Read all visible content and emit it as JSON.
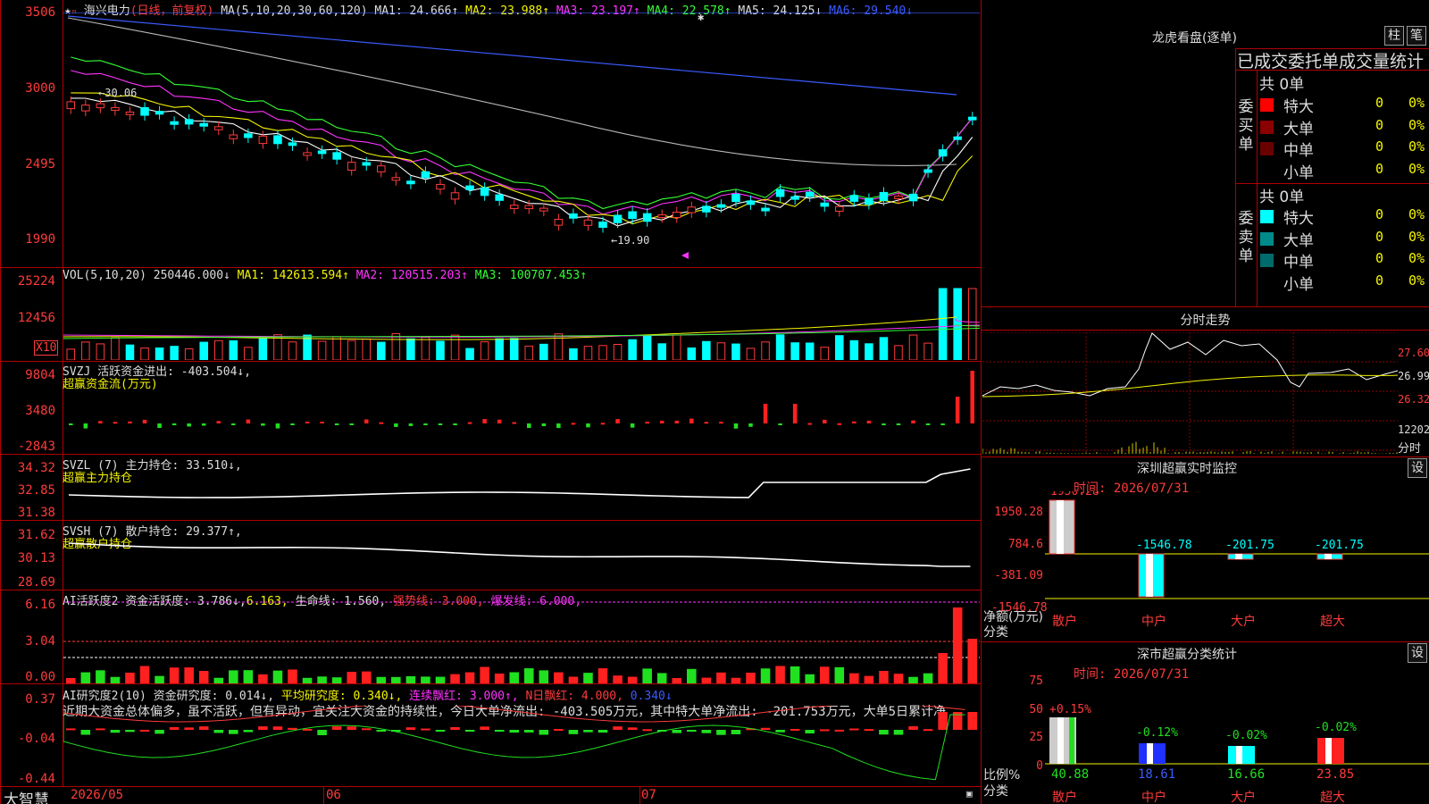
{
  "app": {
    "brand": "大智慧"
  },
  "kline": {
    "title": "海兴电力",
    "period": "(日线，前复权)",
    "ma_label": "MA(5,10,20,30,60,120)",
    "ma": [
      {
        "name": "MA1:",
        "value": "24.666↑",
        "color": "#ddd"
      },
      {
        "name": "MA2:",
        "value": "23.988↑",
        "color": "#f5f500"
      },
      {
        "name": "MA3:",
        "value": "23.197↑",
        "color": "#ff33ff"
      },
      {
        "name": "MA4:",
        "value": "22.578↑",
        "color": "#33ff33"
      },
      {
        "name": "MA5:",
        "value": "24.125↓",
        "color": "#ddd"
      },
      {
        "name": "MA6:",
        "value": "29.540↓",
        "color": "#3b5bff"
      }
    ],
    "y_ticks": [
      "3506",
      "3000",
      "2495",
      "1990"
    ],
    "high_mark": "←30.06",
    "low_mark": "←19.90"
  },
  "vol": {
    "label": "VOL(5,10,20)",
    "value": "250446.000↓",
    "ma1": "MA1: 142613.594↑",
    "ma2": "MA2: 120515.203↑",
    "ma3": "MA3: 100707.453↑",
    "y_ticks": [
      "25224",
      "12456"
    ],
    "unit": "X10"
  },
  "svzj": {
    "label": "SVZJ",
    "line1": "活跃资金进出: -403.504↓,",
    "line2": "超赢资金流(万元)",
    "y_ticks": [
      "9804",
      "3480",
      "-2843"
    ]
  },
  "svzl": {
    "label": "SVZL (7)",
    "line1": "主力持仓: 33.510↓,",
    "line2": "超赢主力持仓",
    "y_ticks": [
      "34.32",
      "32.85",
      "31.38"
    ]
  },
  "svsh": {
    "label": "SVSH (7)",
    "line1": "散户持仓: 29.377↑,",
    "line2": "超赢散户持仓",
    "y_ticks": [
      "31.62",
      "30.13",
      "28.69"
    ]
  },
  "ai_active": {
    "label": "AI活跃度2 资金活跃度:",
    "v1": "3.786↓,",
    "v2": "6.163,",
    "v3": "生命线: 1.560,",
    "v4": "强势线: 3.000,",
    "v5": "爆发线: 6.000,",
    "y_ticks": [
      "6.16",
      "3.04",
      "0.00"
    ]
  },
  "ai_research": {
    "label": "AI研究度2(10) 资金研究度: 0.014↓,",
    "v1": "平均研究度: 0.340↓,",
    "v2": "连续飘红: 3.000↑,",
    "v3": "N日飘红: 4.000,",
    "v4": "0.340↓",
    "commentary": "近期大资金总体偏多，虽不活跃，但有异动，宜关注大资金的持续性，今日大单净流出: -403.505万元，其中特大单净流出: -201.753万元，大单5日累计净",
    "y_ticks": [
      "0.37",
      "-0.04",
      "-0.44"
    ]
  },
  "x_axis": {
    "labels": [
      "2026/05",
      "06",
      "07"
    ]
  },
  "longhu": {
    "title": "龙虎看盘(逐单)",
    "tabs": [
      "柱",
      "笔"
    ],
    "stat_title": "已成交委托单成交量统计",
    "buy_side": {
      "label": "委买单",
      "total": "共 0单",
      "rows": [
        {
          "name": "特大",
          "count": "0",
          "pct": "0%",
          "color": "#ff0000"
        },
        {
          "name": "大单",
          "count": "0",
          "pct": "0%",
          "color": "#8b0000"
        },
        {
          "name": "中单",
          "count": "0",
          "pct": "0%",
          "color": "#6b0000"
        },
        {
          "name": "小单",
          "count": "0",
          "pct": "0%",
          "color": "#000"
        }
      ]
    },
    "sell_side": {
      "label": "委卖单",
      "total": "共 0单",
      "rows": [
        {
          "name": "特大",
          "count": "0",
          "pct": "0%",
          "color": "#00ffff"
        },
        {
          "name": "大单",
          "count": "0",
          "pct": "0%",
          "color": "#008b8b"
        },
        {
          "name": "中单",
          "count": "0",
          "pct": "0%",
          "color": "#006b6b"
        },
        {
          "name": "小单",
          "count": "0",
          "pct": "0%",
          "color": "#000"
        }
      ]
    }
  },
  "intraday": {
    "title": "分时走势",
    "y_ticks": [
      "27.60",
      "26.99",
      "26.32"
    ],
    "vol_label": "12202",
    "bottom_label": "分时"
  },
  "sz_monitor": {
    "title": "深圳超赢实时监控",
    "btn": "设",
    "time": "时间: 2026/07/31",
    "y_ticks": [
      "1950.28",
      "784.6",
      "-381.09",
      "-1546.78"
    ],
    "values": [
      "1950.28",
      "-1546.78",
      "-201.75",
      "-201.75"
    ],
    "ylabel": "净额(万元)",
    "xlabel": "分类",
    "categories": [
      "散户",
      "中户",
      "大户",
      "超大"
    ]
  },
  "sz_class": {
    "title": "深市超赢分类统计",
    "btn": "设",
    "time": "时间: 2026/07/31",
    "y_ticks": [
      "75",
      "50",
      "25",
      "0"
    ],
    "pct_labels": [
      "+0.15%",
      "-0.12%",
      "-0.02%",
      "-0.02%"
    ],
    "values": [
      "40.88",
      "18.61",
      "16.66",
      "23.85"
    ],
    "ylabel": "比例%",
    "xlabel": "分类",
    "categories": [
      "散户",
      "中户",
      "大户",
      "超大"
    ]
  },
  "chart_data": [
    {
      "type": "candlestick",
      "title": "海兴电力",
      "ylabel": "",
      "ylim": [
        17.5,
        35.5
      ]
    },
    {
      "type": "bar",
      "title": "VOL(5,10,20)",
      "ylim": [
        0,
        25224
      ]
    },
    {
      "type": "bar",
      "title": "SVZJ",
      "ylim": [
        -2843,
        9804
      ]
    },
    {
      "type": "line",
      "title": "SVZL",
      "ylim": [
        31.38,
        34.32
      ]
    },
    {
      "type": "line",
      "title": "SVSH",
      "ylim": [
        28.69,
        31.62
      ]
    },
    {
      "type": "bar",
      "title": "AI活跃度2",
      "ylim": [
        0,
        6.16
      ]
    },
    {
      "type": "bar",
      "title": "AI研究度2(10)",
      "ylim": [
        -0.44,
        0.37
      ]
    },
    {
      "type": "bar",
      "title": "深圳超赢实时监控",
      "categories": [
        "散户",
        "中户",
        "大户",
        "超大"
      ],
      "values": [
        1950.28,
        -1546.78,
        -201.75,
        -201.75
      ]
    },
    {
      "type": "bar",
      "title": "深市超赢分类统计",
      "categories": [
        "散户",
        "中户",
        "大户",
        "超大"
      ],
      "values": [
        40.88,
        18.61,
        16.66,
        23.85
      ]
    }
  ]
}
